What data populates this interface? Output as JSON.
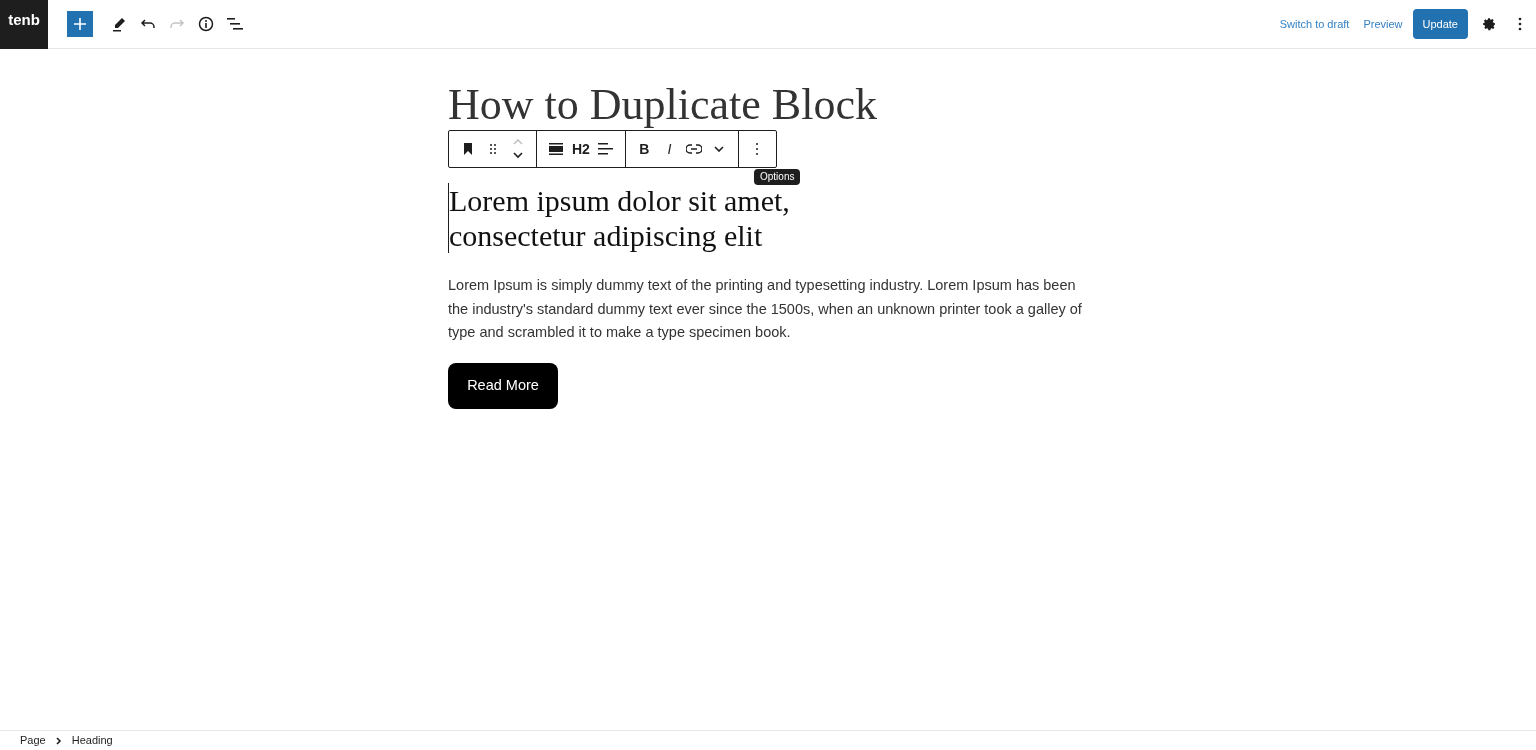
{
  "logo": {
    "text": "tenb"
  },
  "toolbar": [
    {
      "kind": "add"
    },
    {
      "kind": "pen"
    },
    {
      "kind": "undo",
      "disabled": false
    },
    {
      "kind": "redo",
      "disabled": true
    },
    {
      "kind": "info"
    },
    {
      "kind": "outline"
    }
  ],
  "actions": {
    "switch_to_draft": "Switch to draft",
    "preview": "Preview",
    "update": "Update"
  },
  "title": "How to Duplicate Block",
  "block_toolbar": [
    [
      {
        "kind": "bookmark"
      },
      {
        "kind": "drag"
      },
      {
        "kind": "mover"
      }
    ],
    [
      {
        "kind": "align-full"
      },
      {
        "kind": "text",
        "label": "H2"
      },
      {
        "kind": "align-left"
      }
    ],
    [
      {
        "kind": "text",
        "label": "B"
      },
      {
        "kind": "italic",
        "label": "I"
      },
      {
        "kind": "link"
      },
      {
        "kind": "chevron"
      }
    ],
    [
      {
        "kind": "options"
      }
    ]
  ],
  "tooltip": "Options",
  "heading": "Lorem ipsum dolor sit amet, consectetur adipiscing elit",
  "paragraph": "Lorem Ipsum is simply dummy text of the printing and typesetting industry. Lorem Ipsum has been the industry's standard dummy text ever since the 1500s, when an unknown printer took a galley of type and scrambled it to make a type specimen book.",
  "button": "Read More",
  "breadcrumbs": [
    "Page",
    "Heading"
  ]
}
